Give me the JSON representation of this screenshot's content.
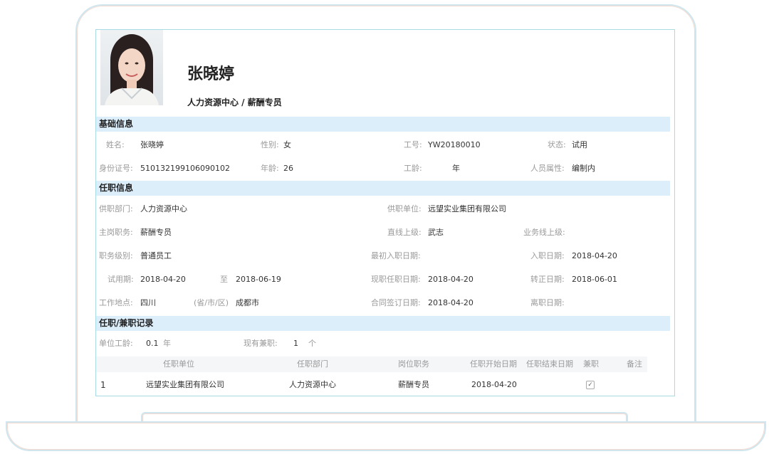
{
  "profile": {
    "name": "张晓婷",
    "department_title": "人力资源中心 / 薪酬专员"
  },
  "sections": {
    "basic": "基础信息",
    "job": "任职信息",
    "records": "任职/兼职记录"
  },
  "basic": {
    "name_label": "姓名:",
    "name_value": "张晓婷",
    "gender_label": "性别:",
    "gender_value": "女",
    "employee_no_label": "工号:",
    "employee_no_value": "YW20180010",
    "status_label": "状态:",
    "status_value": "试用",
    "id_label": "身份证号:",
    "id_value": "510132199106090102",
    "age_label": "年龄:",
    "age_value": "26",
    "seniority_label": "工龄:",
    "seniority_unit": "年",
    "personnel_label": "人员属性:",
    "personnel_value": "编制内"
  },
  "job": {
    "dept_label": "供职部门:",
    "dept_value": "人力资源中心",
    "company_label": "供职单位:",
    "company_value": "远望实业集团有限公司",
    "position_label": "主岗职务:",
    "position_value": "薪酬专员",
    "superior_label": "直线上级:",
    "superior_value": "武志",
    "biz_superior_label": "业务线上级:",
    "grade_label": "职务级别:",
    "grade_value": "普通员工",
    "first_entry_label": "最初入职日期:",
    "entry_label": "入职日期:",
    "entry_value": "2018-04-20",
    "probation_label": "试用期:",
    "probation_start": "2018-04-20",
    "to_label": "至",
    "probation_end": "2018-06-19",
    "current_start_label": "现职任职日期:",
    "current_start_value": "2018-04-20",
    "regular_label": "转正日期:",
    "regular_value": "2018-06-01",
    "location_label": "工作地点:",
    "location_province": "四川",
    "location_hint": "(省/市/区)",
    "location_city": "成都市",
    "contract_label": "合同签订日期:",
    "contract_value": "2018-04-20",
    "leave_label": "离职日期:"
  },
  "records": {
    "unit_seniority_label": "单位工龄:",
    "unit_seniority_value": "0.1",
    "unit_seniority_unit": "年",
    "parttime_label": "现有兼职:",
    "parttime_value": "1",
    "parttime_unit": "个",
    "columns": [
      "任职单位",
      "任职部门",
      "岗位职务",
      "任职开始日期",
      "任职结束日期",
      "兼职",
      "备注"
    ],
    "rows": [
      {
        "index": "1",
        "company": "远望实业集团有限公司",
        "dept": "人力资源中心",
        "position": "薪酬专员",
        "start": "2018-04-20",
        "end": "",
        "parttime_checked": true,
        "note": ""
      }
    ]
  }
}
